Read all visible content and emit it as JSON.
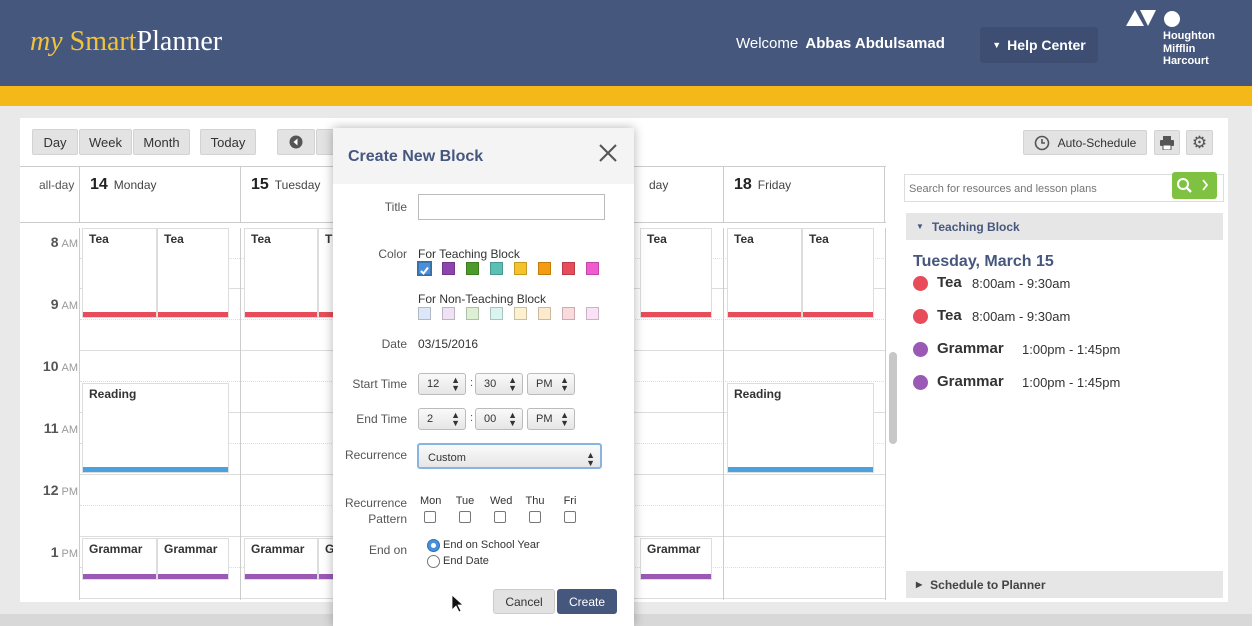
{
  "header": {
    "logo_my": "my",
    "logo_smart": "Smart",
    "logo_planner": "Planner",
    "welcome": "Welcome",
    "user": "Abbas Abdulsamad",
    "help": "Help Center",
    "publisher_line1": "Houghton",
    "publisher_line2": "Mifflin",
    "publisher_line3": "Harcourt"
  },
  "toolbar": {
    "day": "Day",
    "week": "Week",
    "month": "Month",
    "today": "Today",
    "auto_schedule": "Auto-Schedule"
  },
  "calendar": {
    "allday": "all-day",
    "days": [
      {
        "num": "14",
        "name": "Monday"
      },
      {
        "num": "15",
        "name": "Tuesday"
      },
      {
        "num": "",
        "name": "day"
      },
      {
        "num": "18",
        "name": "Friday"
      }
    ],
    "times": [
      {
        "h": "8",
        "p": "AM"
      },
      {
        "h": "9",
        "p": "AM"
      },
      {
        "h": "10",
        "p": "AM"
      },
      {
        "h": "11",
        "p": "AM"
      },
      {
        "h": "12",
        "p": "PM"
      },
      {
        "h": "1",
        "p": "PM"
      }
    ],
    "events": {
      "tea": "Tea",
      "t": "T",
      "reading": "Reading",
      "grammar": "Grammar",
      "g": "G"
    }
  },
  "modal": {
    "title": "Create New Block",
    "title_label": "Title",
    "title_value": "",
    "color_label": "Color",
    "teaching_label": "For Teaching Block",
    "nonteaching_label": "For Non-Teaching Block",
    "teaching_colors": [
      "#4a90d9",
      "#8e44ad",
      "#4c9a2a",
      "#5bbfb5",
      "#f5c22b",
      "#f39c12",
      "#e84c5a",
      "#f25bd0"
    ],
    "nonteaching_colors": [
      "#dce8f7",
      "#f0e2f5",
      "#ddf0d3",
      "#d9f4f1",
      "#fdf1cf",
      "#fde9cc",
      "#fadadd",
      "#fbe1f5"
    ],
    "date_label": "Date",
    "date_value": "03/15/2016",
    "start_label": "Start Time",
    "start_hour": "12",
    "start_min": "30",
    "start_ampm": "PM",
    "end_label": "End Time",
    "end_hour": "2",
    "end_min": "00",
    "end_ampm": "PM",
    "recurrence_label": "Recurrence",
    "recurrence_value": "Custom",
    "pattern_label_1": "Recurrence",
    "pattern_label_2": "Pattern",
    "weekdays": [
      "Mon",
      "Tue",
      "Wed",
      "Thu",
      "Fri"
    ],
    "endon_label": "End on",
    "endon_opt1": "End on School Year",
    "endon_opt2": "End Date",
    "cancel": "Cancel",
    "create": "Create"
  },
  "right_panel": {
    "search_placeholder": "Search for resources and lesson plans",
    "section_title": "Teaching Block",
    "date_heading": "Tuesday, March 15",
    "items": [
      {
        "name": "Tea",
        "time": "8:00am - 9:30am",
        "color": "#e84c5a"
      },
      {
        "name": "Tea",
        "time": "8:00am - 9:30am",
        "color": "#e84c5a"
      },
      {
        "name": "Grammar",
        "time": "1:00pm - 1:45pm",
        "color": "#9b59b6"
      },
      {
        "name": "Grammar",
        "time": "1:00pm - 1:45pm",
        "color": "#9b59b6"
      }
    ],
    "schedule_title": "Schedule to Planner"
  },
  "colors": {
    "header_bg": "#46577e",
    "gold": "#f4b919",
    "tea": "#e84c5a",
    "reading": "#4aa3df",
    "grammar": "#9b59b6",
    "search_green": "#7fc241"
  }
}
